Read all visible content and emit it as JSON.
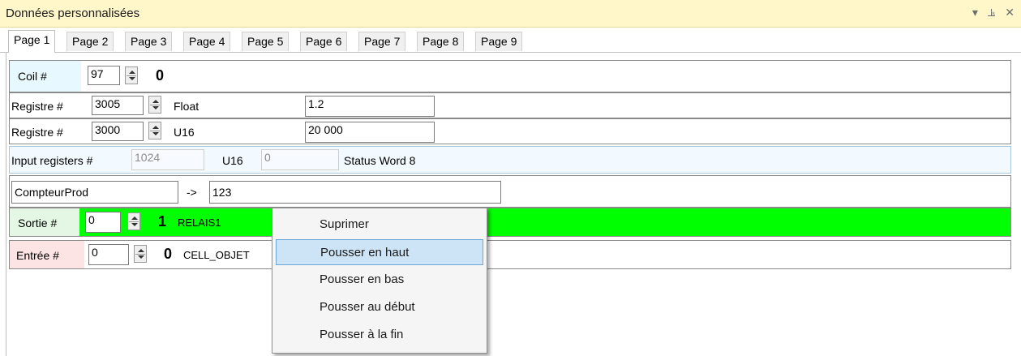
{
  "window": {
    "title": "Données personnalisées",
    "controls": {
      "dropdown": "▾",
      "pin": "ꟷ",
      "close": "✕"
    }
  },
  "tabs": [
    "Page 1",
    "Page 2",
    "Page 3",
    "Page 4",
    "Page 5",
    "Page 6",
    "Page 7",
    "Page 8",
    "Page 9"
  ],
  "active_tab": "Page 1",
  "rows": {
    "coil": {
      "label": "Coil #",
      "address": "97",
      "value": "0"
    },
    "reg1": {
      "label": "Registre #",
      "address": "3005",
      "type": "Float",
      "value": "1.2"
    },
    "reg2": {
      "label": "Registre #",
      "address": "3000",
      "type": "U16",
      "value": "20 000"
    },
    "input_reg": {
      "label": "Input registers #",
      "address": "1024",
      "type": "U16",
      "value": "0",
      "desc": "Status Word 8"
    },
    "compteur": {
      "name": "CompteurProd",
      "arrow": "->",
      "value": "123"
    },
    "sortie": {
      "label": "Sortie #",
      "address": "0",
      "value": "1",
      "name": "RELAIS1"
    },
    "entree": {
      "label": "Entrée #",
      "address": "0",
      "value": "0",
      "name": "CELL_OBJET"
    }
  },
  "colors": {
    "titlebar": "#fff6c9",
    "sortie_bg": "#00ff00",
    "coil_bg": "#e8f8ff",
    "entree_bg": "#fde4e4",
    "menu_highlight": "#cde4f7"
  },
  "context_menu": {
    "items": [
      "Suprimer",
      "Pousser en haut",
      "Pousser en bas",
      "Pousser au début",
      "Pousser à la fin"
    ],
    "highlighted": "Pousser en haut"
  }
}
